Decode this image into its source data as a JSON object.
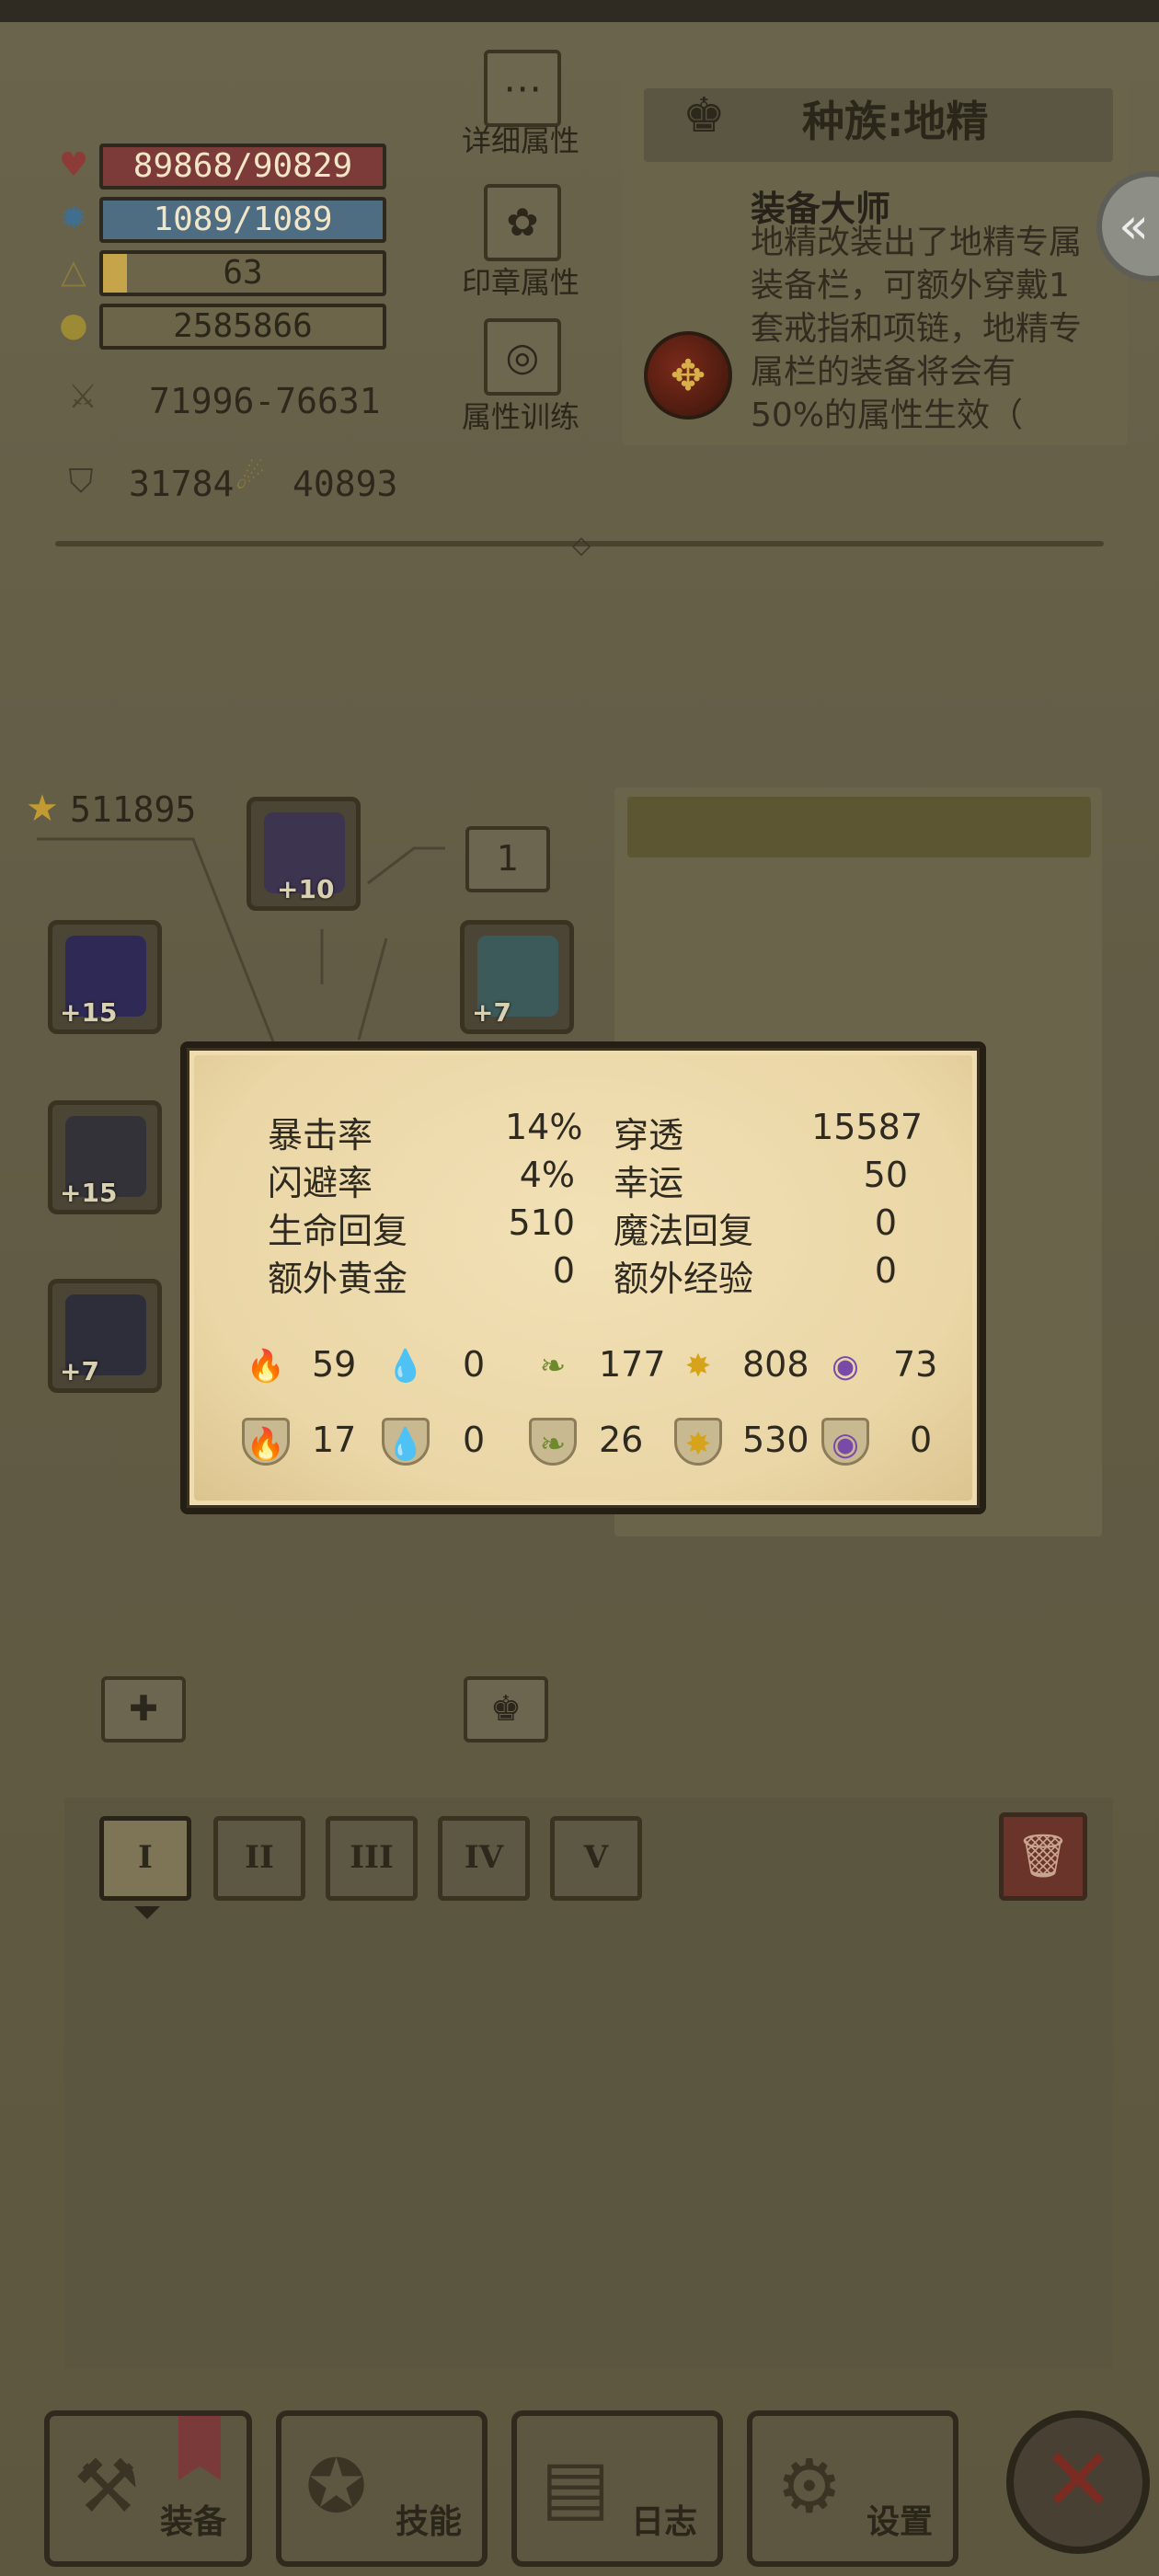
{
  "player": {
    "hp": "89868/90829",
    "mp": "1089/1089",
    "level": "63",
    "gold": "2585866",
    "attack": "71996-76631",
    "defense": "31784",
    "magic_defense": "40893"
  },
  "side_buttons": [
    {
      "label": "详细属性",
      "icon": "dots-icon"
    },
    {
      "label": "印章属性",
      "icon": "seal-icon"
    },
    {
      "label": "属性训练",
      "icon": "target-icon"
    }
  ],
  "race": {
    "title": "种族:地精",
    "skill_name": "装备大师",
    "description": "地精改装出了地精专属装备栏，可额外穿戴1套戒指和项链，地精专属栏的装备将会有50%的属性生效（"
  },
  "equipment": {
    "score": "511895",
    "count_box": "1",
    "slots": [
      {
        "name": "helmet",
        "level": "+10",
        "color": "#3d3550"
      },
      {
        "name": "bracelet",
        "level": "+15",
        "color": "#2f2a55"
      },
      {
        "name": "amulet",
        "level": "+7",
        "color": "#3d5a5a"
      },
      {
        "name": "weapon",
        "level": "+15",
        "color": "#333238"
      },
      {
        "name": "gauntlet",
        "level": "+7",
        "color": "#2e2e3a"
      }
    ]
  },
  "tabs": [
    "I",
    "II",
    "III",
    "IV",
    "V"
  ],
  "popup": {
    "stats_left": [
      {
        "label": "暴击率",
        "value": "14%"
      },
      {
        "label": "闪避率",
        "value": "4%"
      },
      {
        "label": "生命回复",
        "value": "510"
      },
      {
        "label": "额外黄金",
        "value": "0"
      }
    ],
    "stats_right": [
      {
        "label": "穿透",
        "value": "15587"
      },
      {
        "label": "幸运",
        "value": "50"
      },
      {
        "label": "魔法回复",
        "value": "0"
      },
      {
        "label": "额外经验",
        "value": "0"
      }
    ],
    "element_attack": [
      "59",
      "0",
      "177",
      "808",
      "73"
    ],
    "element_defense": [
      "17",
      "0",
      "26",
      "530",
      "0"
    ]
  },
  "nav": [
    {
      "label": "装备",
      "icon": "axe-icon"
    },
    {
      "label": "技能",
      "icon": "skill-icon"
    },
    {
      "label": "日志",
      "icon": "journal-icon"
    },
    {
      "label": "设置",
      "icon": "gear-icon"
    }
  ],
  "colors": {
    "hp": "#7c3b39",
    "mp": "#4e6c82",
    "popup_bg": "#efdcae",
    "close": "#7a2c22"
  }
}
